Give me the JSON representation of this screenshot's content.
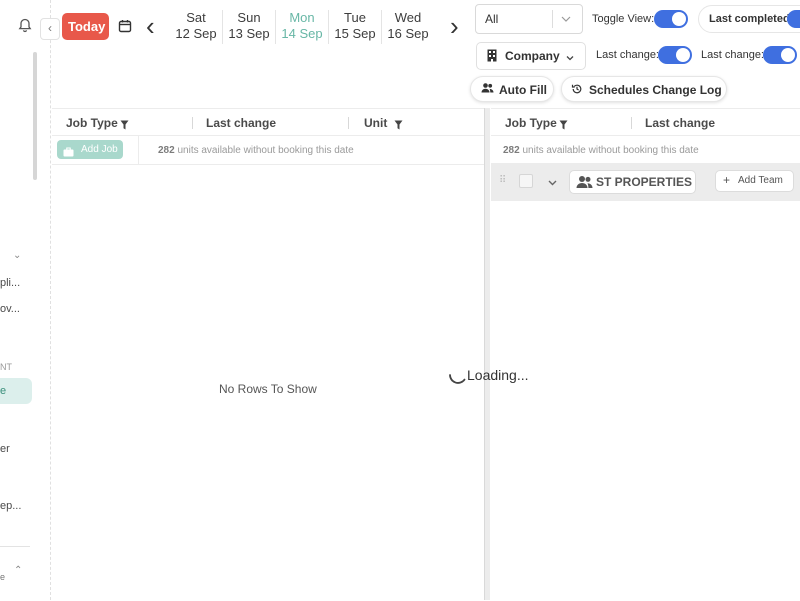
{
  "sidebar": {
    "items": [
      "pli...",
      "ov...",
      "NT",
      "e",
      "er",
      "ep...",
      "e"
    ]
  },
  "toolbar": {
    "today_label": "Today",
    "dates": [
      {
        "day": "Sat",
        "date": "12 Sep"
      },
      {
        "day": "Sun",
        "date": "13 Sep"
      },
      {
        "day": "Mon",
        "date": "14 Sep"
      },
      {
        "day": "Tue",
        "date": "15 Sep"
      },
      {
        "day": "Wed",
        "date": "16 Sep"
      }
    ],
    "active_date_index": 2,
    "filter_value": "All",
    "toggle_view_label": "Toggle View:",
    "last_completed_label": "Last completed",
    "company_label": "Company",
    "last_change_label_1": "Last change:",
    "last_change_label_2": "Last change:",
    "auto_fill_label": "Auto Fill",
    "schedules_log_label": "Schedules Change Log"
  },
  "left_grid": {
    "columns": [
      "Job Type",
      "Last change",
      "Unit"
    ],
    "add_job_label": "Add Job",
    "units_count": "282",
    "units_text": "units available without booking this date",
    "empty_text": "No Rows To Show"
  },
  "right_grid": {
    "columns": [
      "Job Type",
      "Last change"
    ],
    "units_count": "282",
    "units_text": "units available without booking this date",
    "group_name": "ST PROPERTIES",
    "add_team_label": "Add Team"
  },
  "loading_text": "Loading...",
  "colors": {
    "today": "#e8584a",
    "active_date": "#68b7a6",
    "toggle": "#3f6fe0",
    "add_job": "#a9d8cc"
  }
}
